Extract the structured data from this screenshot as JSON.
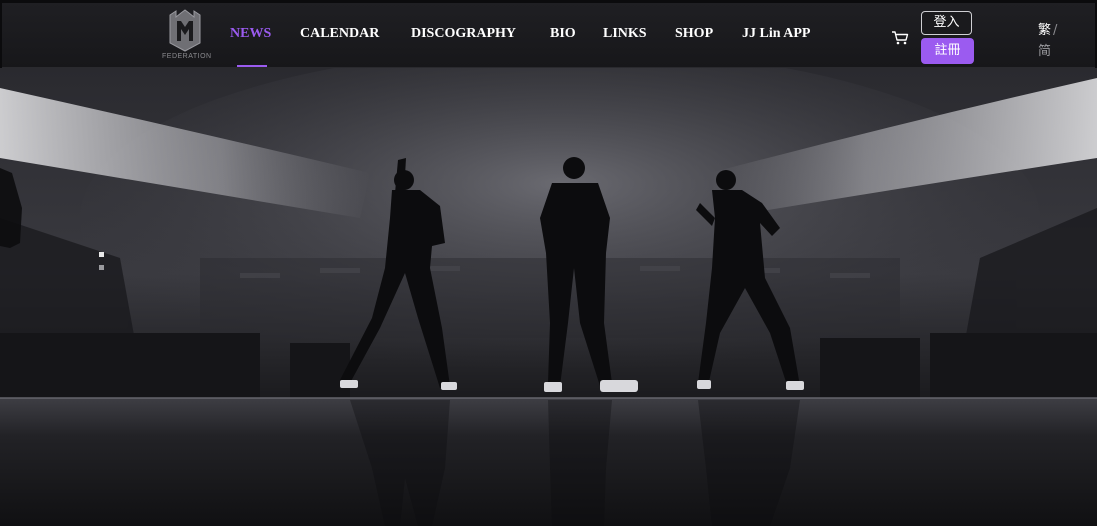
{
  "brand": {
    "logo_text": "FEDERATION"
  },
  "nav": {
    "items": [
      {
        "label": "NEWS",
        "active": true
      },
      {
        "label": "CALENDAR",
        "active": false
      },
      {
        "label": "DISCOGRAPHY",
        "active": false
      },
      {
        "label": "BIO",
        "active": false
      },
      {
        "label": "LINKS",
        "active": false
      },
      {
        "label": "SHOP",
        "active": false
      },
      {
        "label": "JJ Lin APP",
        "active": false
      }
    ]
  },
  "account": {
    "login_label": "登入",
    "register_label": "註冊"
  },
  "language": {
    "traditional": "繁",
    "separator": "/",
    "simplified": "简"
  },
  "icons": {
    "cart": "cart-icon",
    "logo": "federation-logo"
  },
  "colors": {
    "accent": "#9b5bf0",
    "header_bg": "#1c1c20",
    "text": "#ffffff"
  },
  "hero": {
    "slide_count": 2,
    "active_slide": 1
  }
}
